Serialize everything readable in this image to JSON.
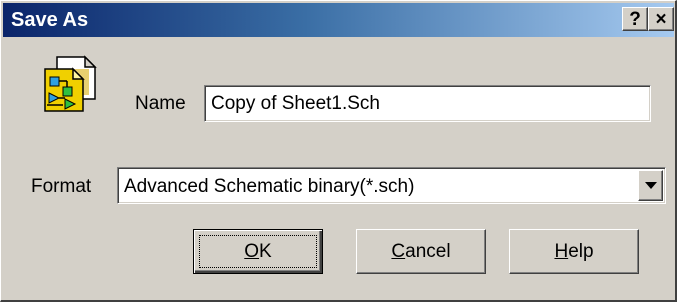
{
  "window": {
    "title": "Save As",
    "help_button": "?",
    "close_button": "×"
  },
  "form": {
    "name_label": "Name",
    "name_value": "Copy of Sheet1.Sch",
    "format_label": "Format",
    "format_value": "Advanced Schematic binary(*.sch)"
  },
  "buttons": {
    "ok": {
      "mnemonic": "O",
      "rest": "K"
    },
    "cancel": {
      "mnemonic": "C",
      "rest": "ancel"
    },
    "help": {
      "mnemonic": "H",
      "rest": "elp"
    }
  },
  "icons": {
    "app": "schematic-document-icon",
    "dropdown": "dropdown-arrow-icon"
  },
  "colors": {
    "titlebar_start": "#0a246a",
    "titlebar_end": "#a6caf0",
    "face": "#d4d0c8"
  }
}
